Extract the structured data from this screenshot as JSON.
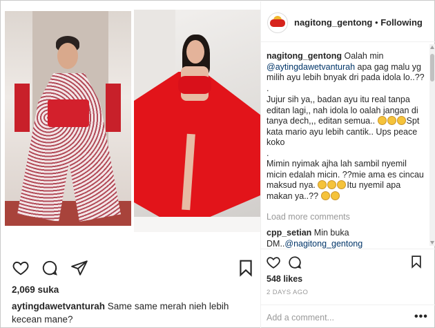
{
  "post": {
    "author": "nagitong_gentong",
    "follow_state": "Following",
    "separator": "•",
    "images": [
      "photo-left-kimono-dress",
      "photo-right-red-gown"
    ]
  },
  "left": {
    "likes": "2,069 suka",
    "caption_user": "aytingdawetvanturah",
    "caption_text": "Same same merah nieh lebih kecean mane?",
    "icons": [
      "heart-icon",
      "comment-icon",
      "share-icon",
      "bookmark-icon"
    ]
  },
  "right": {
    "comment_user": "nagitong_gentong",
    "comment_line1": "Oalah min",
    "comment_mention": "@aytingdawetvanturah",
    "comment_line2": "apa gag malu yg milih ayu lebih bnyak dri pada idola lo..?? .",
    "comment_line3": "Jujur sih ya,, badan ayu itu real tanpa editan lagi,, nah idola lo oalah jangan di tanya dech,,, editan semua..",
    "comment_line3b": "Spt kata mario ayu lebih cantik.. Ups peace koko",
    "comment_dot": ".",
    "comment_line4": "Mimin nyimak ajha lah sambil nyemil micin edalah micin. ??mie ama es cincau maksud nya.",
    "comment_line4b": "Itu nyemil apa makan ya..??",
    "load_more": "Load more comments",
    "reply_user": "cpp_setian",
    "reply_text": "Min buka DM..",
    "reply_mention": "@nagitong_gentong",
    "likes": "548 likes",
    "timestamp": "2 DAYS AGO",
    "add_comment_placeholder": "Add a comment...",
    "more_label": "•••",
    "icons": [
      "heart-icon",
      "comment-icon",
      "bookmark-icon"
    ]
  },
  "colors": {
    "text": "#262626",
    "muted": "#999999",
    "link": "#003569",
    "border": "#efefef",
    "dress_red": "#e2141a"
  }
}
